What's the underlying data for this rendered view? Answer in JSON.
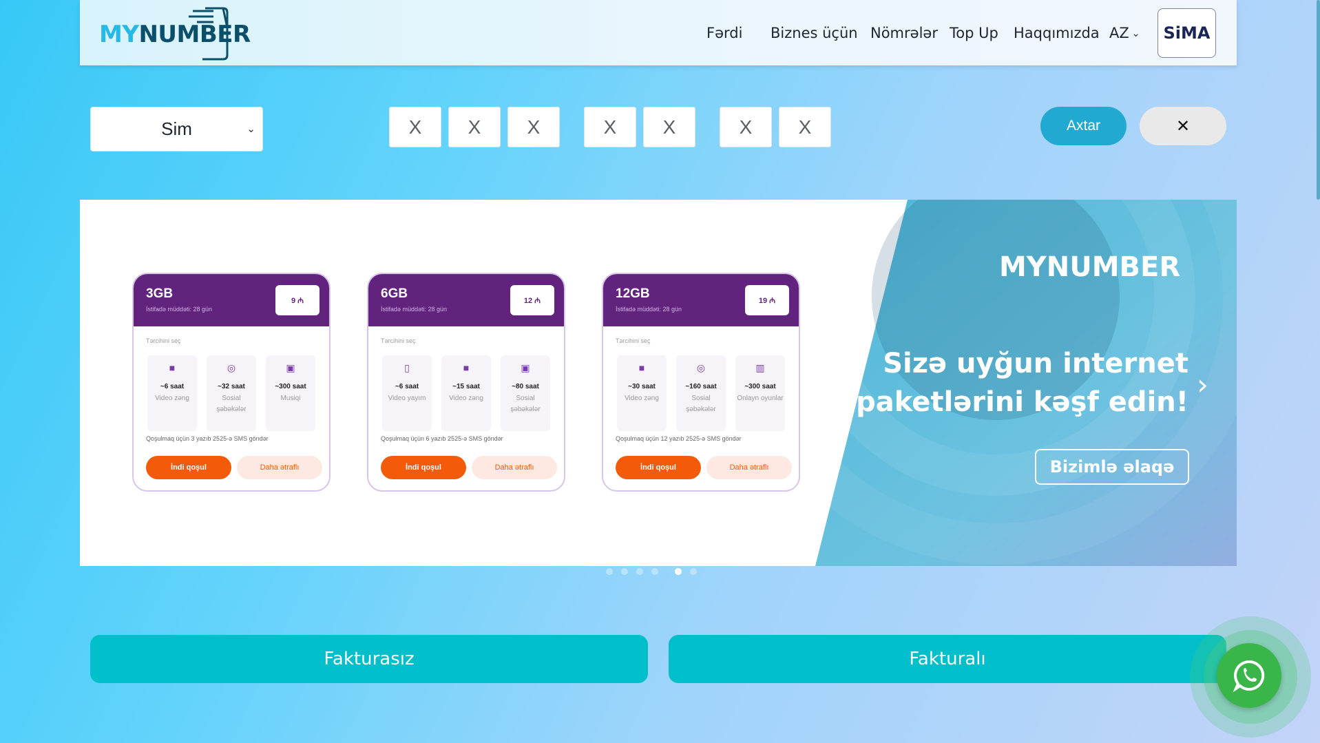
{
  "header": {
    "logo_my": "MY",
    "logo_number": "NUMBER",
    "nav": [
      "Fərdi",
      "Biznes üçün",
      "Nömrələr",
      "Top Up",
      "Haqqımızda"
    ],
    "lang": "AZ",
    "sima_a": "Si",
    "sima_b": "MA"
  },
  "search": {
    "select_value": "Sim",
    "digits": [
      "X",
      "X",
      "X",
      "X",
      "X",
      "X",
      "X"
    ],
    "search_label": "Axtar",
    "clear_label": "✕"
  },
  "banner": {
    "cards": [
      {
        "gb": "3GB",
        "sub": "İstifadə müddəti: 28 gün",
        "price": "9 ₼",
        "choose": "Tərcihini seç",
        "options": [
          {
            "icon": "video-icon",
            "value": "~6 saat",
            "label": "Video zəng"
          },
          {
            "icon": "instagram-icon",
            "value": "~32 saat",
            "label": "Sosial şəbəkələr"
          },
          {
            "icon": "music-icon",
            "value": "~300 saat",
            "label": "Musiqi"
          }
        ],
        "note": "Qoşulmaq üçün 3 yazıb 2525-ə SMS göndər",
        "btn1": "İndi qoşul",
        "btn2": "Daha ətraflı"
      },
      {
        "gb": "6GB",
        "sub": "İstifadə müddəti: 28 gün",
        "price": "12 ₼",
        "choose": "Tərcihini seç",
        "options": [
          {
            "icon": "phone-icon",
            "value": "~6 saat",
            "label": "Video yayım"
          },
          {
            "icon": "video-icon",
            "value": "~15 saat",
            "label": "Video zəng"
          },
          {
            "icon": "music-icon",
            "value": "~80 saat",
            "label": "Sosial şəbəkələr"
          }
        ],
        "note": "Qoşulmaq üçün 6 yazıb 2525-ə SMS göndər",
        "btn1": "İndi qoşul",
        "btn2": "Daha ətraflı"
      },
      {
        "gb": "12GB",
        "sub": "İstifadə müddəti: 28 gün",
        "price": "19 ₼",
        "choose": "Tərcihini seç",
        "options": [
          {
            "icon": "video-icon",
            "value": "~30 saat",
            "label": "Video zəng"
          },
          {
            "icon": "instagram-icon",
            "value": "~160 saat",
            "label": "Sosial şəbəkələr"
          },
          {
            "icon": "gift-icon",
            "value": "~300 saat",
            "label": "Onlayn oyunlar"
          }
        ],
        "note": "Qoşulmaq üçün 12 yazıb 2525-ə SMS göndər",
        "btn1": "İndi qoşul",
        "btn2": "Daha ətraflı"
      }
    ],
    "logo": "MYNUMBER",
    "title_line1": "Sizə uyğun internet",
    "title_line2": "paketlərini kəşf edin!",
    "cta": "Bizimlə əlaqə"
  },
  "tabs": {
    "left": "Fakturasız",
    "right": "Fakturalı"
  },
  "colors": {
    "accent": "#22a9d2",
    "tab": "#00bfca",
    "card_header": "#62237e",
    "orange": "#f35b0a",
    "whatsapp": "#39b54a"
  }
}
